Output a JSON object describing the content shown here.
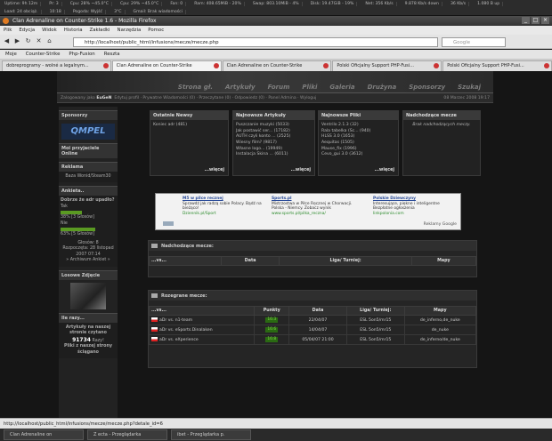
{
  "sysbar": {
    "row1": [
      "Uptime: 9h 12m",
      "Pr: 3",
      "Cpu: 28% ~45.0°C",
      "Cpu: 29% ~45.0°C",
      "Fan: 0",
      "Ram: 408.65MiB - 20%",
      "Swap: 803.10MiB - 4%",
      "Disk: 19.47GiB - 19%",
      "Net: 356 Kb/s",
      "9.878 Kb/s down",
      "36 Kb/s",
      "1.080 B up"
    ],
    "row2": [
      "Load: 24 obciąż.",
      "10:18",
      "Pogoda: Wyjść",
      "3°C",
      "Gmail: Brak wiadomości"
    ]
  },
  "window": {
    "title": "Clan Adrenaline on Counter-Strike 1.6 - Mozilla Firefox",
    "buttons": [
      "_",
      "□",
      "×"
    ]
  },
  "menu": [
    "Plik",
    "Edycja",
    "Widok",
    "Historia",
    "Zakładki",
    "Narzędzia",
    "Pomoc"
  ],
  "nav": {
    "url": "http://localhost/public_html/infusions/mecze/mecze.php",
    "search_placeholder": "Google"
  },
  "bookmarks": [
    "Moje",
    "Counter-Strike",
    "Php-Fusion",
    "Reszta"
  ],
  "tabs": [
    {
      "label": "dobreprogramy - wolné a legalnym...",
      "active": false
    },
    {
      "label": "Clan Adrenaline on Counter-Strike",
      "active": true
    },
    {
      "label": "Clan Adrenaline on Counter-Strike",
      "active": false
    },
    {
      "label": "Polski Oficjalny Support PHP-Fusi...",
      "active": false
    },
    {
      "label": "Polski Oficjalny Support PHP-Fusi...",
      "active": false
    }
  ],
  "site": {
    "nav": [
      "Strona gł.",
      "Artykuły",
      "Forum",
      "Pliki",
      "Galeria",
      "Drużyna",
      "Sponsorzy",
      "Szukaj"
    ],
    "login": {
      "prefix": "Zalogowany jako",
      "user": "EuGeN",
      "links": "Edytuj profil · Prywatne Wiadomości (0) · Przeczytane (0) · Odpowiedz (0) · Panel Admina · Wyloguj",
      "date": "08 Marzec 2008 19:17"
    },
    "sidebar": {
      "sponsors_title": "Sponsorzy",
      "sponsor_logo": "QMPEL",
      "online_title": "Moi przyjaciele Online",
      "ads_title": "Reklama",
      "ads_text": "Baza Wonid/Steam30",
      "poll_title": "Ankieta..",
      "poll_q": "Dobrze że adr upadło?",
      "poll_opt1": "Tak",
      "poll_pct1": "38% [3 Głosów]",
      "poll_opt2": "Nie",
      "poll_pct2": "63% [5 Głosów]",
      "poll_votes": "Głosów: 8",
      "poll_started": "Rozpoczęta: 28 listopad 2007 07:14",
      "poll_archive": "» Archiwum Ankiet »",
      "photo_title": "Losowe Zdjęcie",
      "now_title": "Ile razy...",
      "now_text": "Artykuły na naszej stronie czytano",
      "now_count": "91734",
      "now_suffix": "Razy!",
      "files_text": "Pliki z naszej strony ściągano"
    },
    "boxes": [
      {
        "title": "Ostatnie Newsy",
        "items": [
          "Koniec adr (481)"
        ],
        "more": "...więcej"
      },
      {
        "title": "Najnowsze Artykuły",
        "items": [
          "Puszczanie muzyki (5033)",
          "Jak postawić ser... (17182)",
          "AUTH czyli konto ... (2525)",
          "Wiesny film? (9817)",
          "Własne logo... (19949)",
          "Instalacja Skina ... (6011)"
        ],
        "more": "...więcej"
      },
      {
        "title": "Najnowsze Pliki",
        "items": [
          "Ventrilo 2.1.3 (32)",
          "Rala tabelka (Sc... (940)",
          "HLSS 3.0 (1653)",
          "Aequitas (1505)",
          "Mause_fix (1996)",
          "Cevo_gui 3.0 (3612)"
        ],
        "more": "...więcej"
      },
      {
        "title": "Nadchodzące mecze",
        "items": [
          "Brak nadchodzących meczy."
        ],
        "more": ""
      }
    ],
    "ads": [
      {
        "title": "M5 w pilce recznej",
        "text": "Sprawdź jak radzą sobie Polacy. Bądź na bieżąco!",
        "url": "Dziennik.pl/Sport"
      },
      {
        "title": "Sports.pl",
        "text": "Mistrzostwa w Piłce Ręcznej w Chorwacji. Polska - Niemcy. Zobacz wynik",
        "url": "www.sports.pl/pilka_reczna/"
      },
      {
        "title": "Polskie Dziewczyny",
        "text": "Interesujące, piękne i inteligentne Bezpłatne ogłoszenia",
        "url": "linkpolonia.com"
      }
    ],
    "ads_by": "Reklamy Google",
    "upcoming": {
      "title": "Nadchodzące mecze:",
      "cols": [
        "...vs...",
        "Data",
        "Liga/ Turniej:",
        "Mapy"
      ]
    },
    "played": {
      "title": "Rozegrane mecze:",
      "cols": [
        "...vs...",
        "Punkty",
        "Data",
        "Liga/ Turniej:",
        "Mapy"
      ],
      "rows": [
        {
          "vs": "aDr vs. n1-team",
          "pts": "16:3",
          "date": "22/04/07",
          "league": "ESL 5on5/mr15",
          "map": "de_inferno,de_nuke"
        },
        {
          "vs": "aDr vs. eSports.Dinalaken",
          "pts": "16:6",
          "date": "14/04/07",
          "league": "ESL 5on5/mr15",
          "map": "de_nuke"
        },
        {
          "vs": "aDr vs. eXperience",
          "pts": "16:8",
          "date": "05/04/07 21:00",
          "league": "ESL 5on5/mr15",
          "map": "de_inferno/de_nuke"
        }
      ]
    }
  },
  "status": "http://localhost/public_html/infusions/mecze/mecze.php?detale_id=6",
  "taskbar": [
    "Clan Adrenaline on",
    "Z ecta - Przeglądarka",
    "ibet - Przeglądarka p."
  ]
}
